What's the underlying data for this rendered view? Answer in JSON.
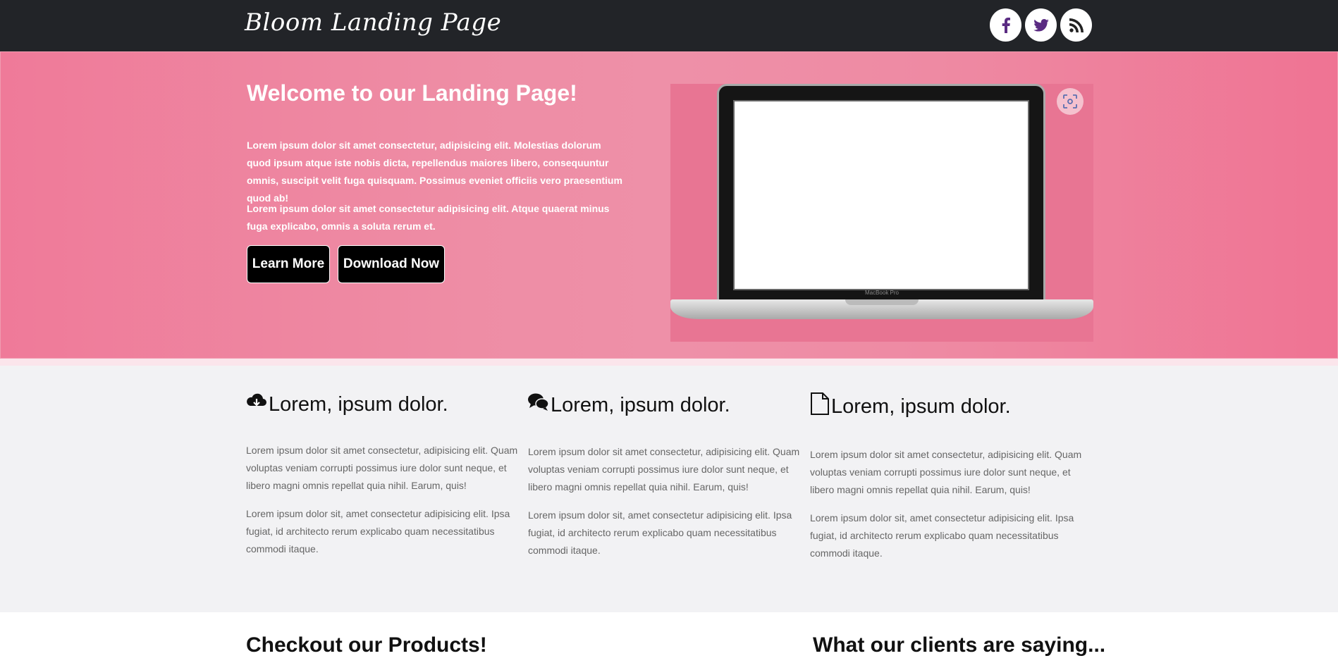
{
  "header": {
    "logo": "Bloom Landing Page",
    "social": [
      "facebook-icon",
      "twitter-icon",
      "rss-icon"
    ],
    "accent_color": "#5a2b82"
  },
  "hero": {
    "title": "Welcome to our Landing Page!",
    "paragraph1": "Lorem ipsum dolor sit amet consectetur, adipisicing elit. Molestias dolorum quod ipsum atque iste nobis dicta, repellendus maiores libero, consequuntur omnis, suscipit velit fuga quisquam. Possimus eveniet officiis vero praesentium quod ab!",
    "paragraph2": "Lorem ipsum dolor sit amet consectetur adipisicing elit. Atque quaerat minus fuga explicabo, omnis a soluta rerum et.",
    "learn_more": "Learn More",
    "download_now": "Download Now",
    "laptop_label": "MacBook Pro",
    "background": "#ee8aa3"
  },
  "features": [
    {
      "icon": "cloud-download-icon",
      "title": "Lorem, ipsum dolor.",
      "p1": "Lorem ipsum dolor sit amet consectetur, adipisicing elit. Quam voluptas veniam corrupti possimus iure dolor sunt neque, et libero magni omnis repellat quia nihil. Earum, quis!",
      "p2": "Lorem ipsum dolor sit, amet consectetur adipisicing elit. Ipsa fugiat, id architecto rerum explicabo quam necessitatibus commodi itaque."
    },
    {
      "icon": "chat-bubbles-icon",
      "title": "Lorem, ipsum dolor.",
      "p1": "Lorem ipsum dolor sit amet consectetur, adipisicing elit. Quam voluptas veniam corrupti possimus iure dolor sunt neque, et libero magni omnis repellat quia nihil. Earum, quis!",
      "p2": "Lorem ipsum dolor sit, amet consectetur adipisicing elit. Ipsa fugiat, id architecto rerum explicabo quam necessitatibus commodi itaque."
    },
    {
      "icon": "document-icon",
      "title": "Lorem, ipsum dolor.",
      "p1": "Lorem ipsum dolor sit amet consectetur, adipisicing elit. Quam voluptas veniam corrupti possimus iure dolor sunt neque, et libero magni omnis repellat quia nihil. Earum, quis!",
      "p2": "Lorem ipsum dolor sit, amet consectetur adipisicing elit. Ipsa fugiat, id architecto rerum explicabo quam necessitatibus commodi itaque."
    }
  ],
  "bottom": {
    "products_title": "Checkout our Products!",
    "clients_title": "What our clients are saying..."
  }
}
